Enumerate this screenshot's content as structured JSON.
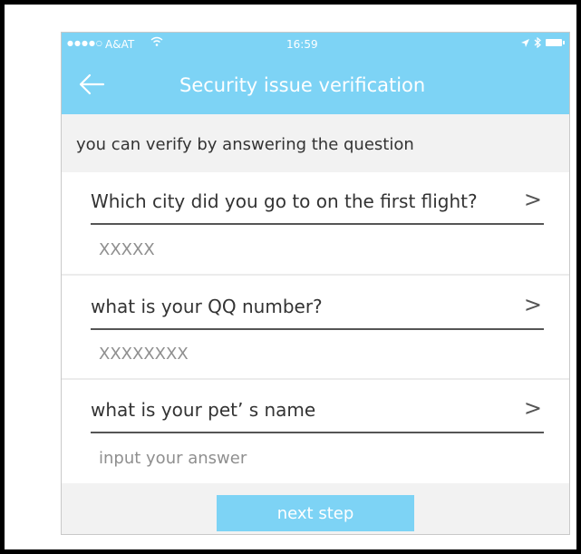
{
  "status_bar": {
    "signal": "●●●●○",
    "carrier": "A&AT",
    "wifi_icon": "wifi-icon",
    "time": "16:59",
    "location_icon": "location-arrow-icon",
    "bluetooth_icon": "bluetooth-icon",
    "battery_icon": "battery-icon"
  },
  "header": {
    "back_icon": "arrow-left-icon",
    "title": "Security issue verification"
  },
  "hint": "you can verify by answering the question",
  "questions": [
    {
      "question": "Which city did you go to on the first flight?",
      "answer": "XXXXX"
    },
    {
      "question": "what is your QQ number?",
      "answer": "XXXXXXXX"
    },
    {
      "question": "what is your pet’ s name",
      "answer_placeholder": "input your answer"
    }
  ],
  "chevron_glyph": ">",
  "next_button": "next step",
  "colors": {
    "accent": "#7dd3f5",
    "section_bg": "#f2f2f2",
    "text": "#333333",
    "muted_text": "#8f8f8f"
  }
}
